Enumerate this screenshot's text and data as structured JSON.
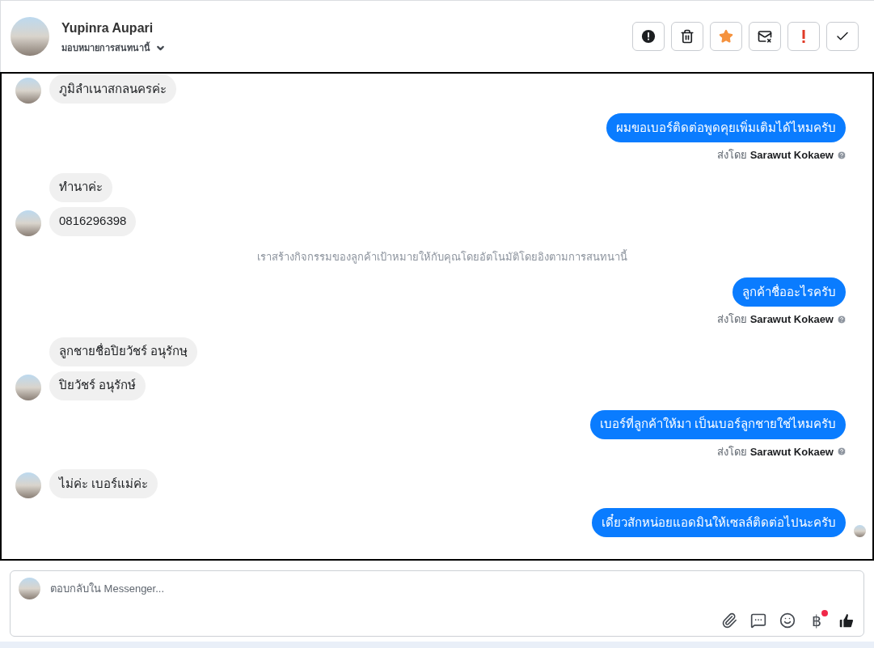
{
  "header": {
    "name": "Yupinra Aupari",
    "assign_label": "มอบหมายการสนทนานี้"
  },
  "actions": [
    {
      "kind": "alert"
    },
    {
      "kind": "trash"
    },
    {
      "kind": "star"
    },
    {
      "kind": "mail"
    },
    {
      "kind": "important"
    },
    {
      "kind": "done"
    }
  ],
  "messages": [
    {
      "kind": "incoming",
      "text": "ภูมิลำเนาสกลนครค่ะ",
      "avatar": true
    },
    {
      "kind": "outgoing",
      "text": "ผมขอเบอร์ติดต่อพูดคุยเพิ่มเติมได้ไหมครับ",
      "sent_by_label": "ส่งโดย",
      "sender": "Sarawut Kokaew",
      "seen": false
    },
    {
      "kind": "incoming",
      "text": "ทำนาค่ะ",
      "avatar": false
    },
    {
      "kind": "incoming",
      "text": "0816296398",
      "avatar": true
    },
    {
      "kind": "system",
      "text": "เราสร้างกิจกรรมของลูกค้าเป้าหมายให้กับคุณโดยอัตโนมัติโดยอิงตามการสนทนานี้"
    },
    {
      "kind": "outgoing",
      "text": "ลูกค้าชื่ออะไรครับ",
      "sent_by_label": "ส่งโดย",
      "sender": "Sarawut Kokaew",
      "seen": false
    },
    {
      "kind": "incoming",
      "text": "ลูกชายชื่อปิยวัชร์ อนุรักษฺ",
      "avatar": false
    },
    {
      "kind": "incoming",
      "text": "ปิยวัชร์ อนุรักษ์",
      "avatar": true
    },
    {
      "kind": "outgoing",
      "text": "เบอร์ที่ลูกค้าให้มา เป็นเบอร์ลูกชายใช่ไหมครับ",
      "sent_by_label": "ส่งโดย",
      "sender": "Sarawut Kokaew",
      "seen": false
    },
    {
      "kind": "incoming",
      "text": "ไม่ค่ะ เบอร์แม่ค่ะ",
      "avatar": true
    },
    {
      "kind": "outgoing",
      "text": "เดี๋ยวสักหน่อยแอดมินให้เซลล์ติดต่อไปนะครับ",
      "seen": true
    }
  ],
  "composer": {
    "placeholder": "ตอบกลับใน Messenger...",
    "tools": [
      {
        "kind": "attach"
      },
      {
        "kind": "reply"
      },
      {
        "kind": "emoji"
      },
      {
        "kind": "currency",
        "symbol": "฿",
        "badge": true
      },
      {
        "kind": "like"
      }
    ]
  }
}
